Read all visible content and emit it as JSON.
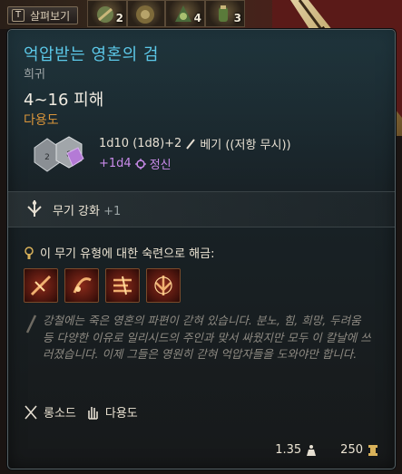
{
  "top_bar": {
    "inspect_key": "T",
    "inspect_label": "살펴보기",
    "hotbar_counts": [
      "2",
      "4",
      "3"
    ]
  },
  "item": {
    "name": "억압받는 영혼의 검",
    "rarity": "희귀",
    "damage_range": "4~16 피해",
    "weapon_property": "다용도",
    "damage_formula": "1d10 (1d8)+2",
    "damage_type": "베기 ((저항 무시))",
    "bonus_damage": "+1d4",
    "bonus_damage_type": "정신",
    "enchantment_label": "무기 강화",
    "enchantment_value": "+1",
    "proficiency_unlock": "이 무기 유형에 대한 숙련으로 해금:",
    "flavor_text": "강철에는 죽은 영혼의 파편이 갇혀 있습니다. 분노, 힘, 희망, 두려움 등 다양한 이유로 일리시드의 주인과 맞서 싸웠지만 모두 이 칼날에 쓰러졌습니다. 이제 그들은 영원히 갇혀 억압자들을 도와야만 합니다.",
    "tags": [
      "롱소드",
      "다용도"
    ],
    "weight": "1.35",
    "price": "250"
  },
  "colors": {
    "title": "#5cc8e8",
    "property": "#d9953a",
    "psychic": "#c98bea",
    "flavor": "#8e8a82"
  },
  "icons": [
    "dice-icon",
    "slash-icon",
    "psychic-icon",
    "enchant-icon",
    "lock-icon",
    "skill-icon",
    "longsword-icon",
    "hand-icon",
    "weight-icon",
    "gold-icon"
  ]
}
